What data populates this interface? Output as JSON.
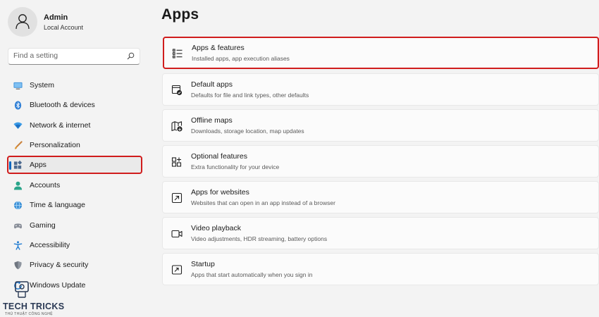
{
  "profile": {
    "name": "Admin",
    "account_type": "Local Account"
  },
  "search": {
    "placeholder": "Find a setting",
    "value": ""
  },
  "sidebar": {
    "items": [
      {
        "label": "System",
        "icon": "monitor-icon"
      },
      {
        "label": "Bluetooth & devices",
        "icon": "bluetooth-icon"
      },
      {
        "label": "Network & internet",
        "icon": "wifi-icon"
      },
      {
        "label": "Personalization",
        "icon": "brush-icon"
      },
      {
        "label": "Apps",
        "icon": "apps-icon",
        "selected": true
      },
      {
        "label": "Accounts",
        "icon": "person-icon"
      },
      {
        "label": "Time & language",
        "icon": "globe-clock-icon"
      },
      {
        "label": "Gaming",
        "icon": "gamepad-icon"
      },
      {
        "label": "Accessibility",
        "icon": "accessibility-icon"
      },
      {
        "label": "Privacy & security",
        "icon": "shield-icon"
      },
      {
        "label": "Windows Update",
        "icon": "update-icon"
      }
    ]
  },
  "main": {
    "title": "Apps",
    "cards": [
      {
        "title": "Apps & features",
        "subtitle": "Installed apps, app execution aliases",
        "icon": "list-icon",
        "highlighted": true
      },
      {
        "title": "Default apps",
        "subtitle": "Defaults for file and link types, other defaults",
        "icon": "default-apps-icon"
      },
      {
        "title": "Offline maps",
        "subtitle": "Downloads, storage location, map updates",
        "icon": "map-icon"
      },
      {
        "title": "Optional features",
        "subtitle": "Extra functionality for your device",
        "icon": "grid-plus-icon"
      },
      {
        "title": "Apps for websites",
        "subtitle": "Websites that can open in an app instead of a browser",
        "icon": "open-in-app-icon"
      },
      {
        "title": "Video playback",
        "subtitle": "Video adjustments, HDR streaming, battery options",
        "icon": "video-icon"
      },
      {
        "title": "Startup",
        "subtitle": "Apps that start automatically when you sign in",
        "icon": "startup-icon"
      }
    ]
  },
  "watermark": {
    "brand": "TECH TRICKS",
    "tagline": "THỦ THUẬT CÔNG NGHỆ"
  },
  "colors": {
    "accent": "#0067c0",
    "highlight_border": "#d01c1c",
    "background": "#f3f3f3",
    "card": "#fbfbfb"
  }
}
